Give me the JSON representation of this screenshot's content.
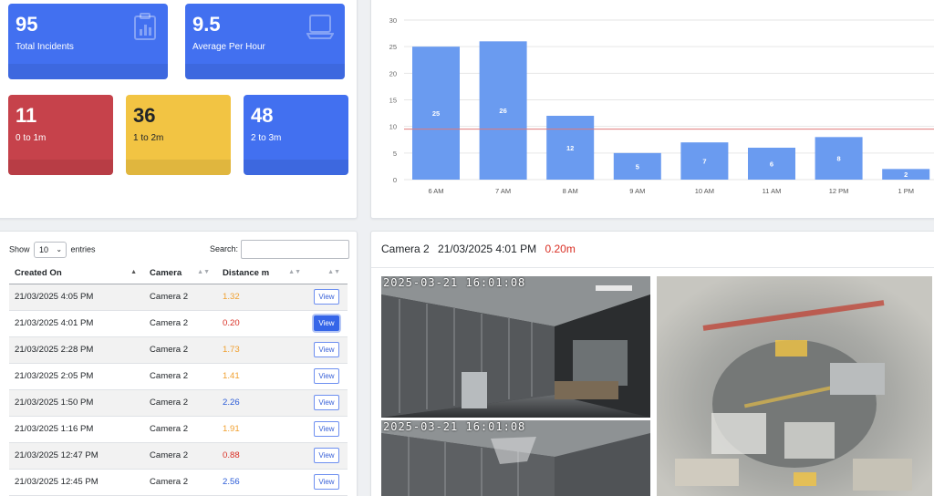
{
  "stats": {
    "total": {
      "value": "95",
      "label": "Total Incidents",
      "icon": "clipboard-chart-icon"
    },
    "average": {
      "value": "9.5",
      "label": "Average Per Hour",
      "icon": "laptop-icon"
    },
    "range1": {
      "value": "11",
      "label": "0 to 1m"
    },
    "range2": {
      "value": "36",
      "label": "1 to 2m"
    },
    "range3": {
      "value": "48",
      "label": "2 to 3m"
    },
    "colors": {
      "blue": "#4270f0",
      "red": "#c6424b",
      "yellow": "#f2c443"
    }
  },
  "chart_data": {
    "type": "bar",
    "categories": [
      "6 AM",
      "7 AM",
      "8 AM",
      "9 AM",
      "10 AM",
      "11 AM",
      "12 PM",
      "1 PM"
    ],
    "values": [
      25,
      26,
      12,
      5,
      7,
      6,
      8,
      2
    ],
    "ylim": [
      0,
      30
    ],
    "yticks": [
      0,
      5,
      10,
      15,
      20,
      25,
      30
    ],
    "average_line": 9.5,
    "grid": true,
    "bar_color": "#6a9bf0",
    "line_color": "#e07a7a"
  },
  "table": {
    "show_label": "Show",
    "entries_value": "10",
    "entries_label": "entries",
    "search_label": "Search:",
    "headers": [
      "Created On",
      "Camera",
      "Distance m",
      ""
    ],
    "view_label": "View",
    "rows": [
      {
        "created": "21/03/2025 4:05 PM",
        "camera": "Camera 2",
        "distance": "1.32",
        "color": "#f0a030"
      },
      {
        "created": "21/03/2025 4:01 PM",
        "camera": "Camera 2",
        "distance": "0.20",
        "color": "#d93025"
      },
      {
        "created": "21/03/2025 2:28 PM",
        "camera": "Camera 2",
        "distance": "1.73",
        "color": "#f0a030"
      },
      {
        "created": "21/03/2025 2:05 PM",
        "camera": "Camera 2",
        "distance": "1.41",
        "color": "#f0a030"
      },
      {
        "created": "21/03/2025 1:50 PM",
        "camera": "Camera 2",
        "distance": "2.26",
        "color": "#2a5bd7"
      },
      {
        "created": "21/03/2025 1:16 PM",
        "camera": "Camera 2",
        "distance": "1.91",
        "color": "#f0a030"
      },
      {
        "created": "21/03/2025 12:47 PM",
        "camera": "Camera 2",
        "distance": "0.88",
        "color": "#d93025"
      },
      {
        "created": "21/03/2025 12:45 PM",
        "camera": "Camera 2",
        "distance": "2.56",
        "color": "#2a5bd7"
      }
    ],
    "active_row": 1
  },
  "camera": {
    "name": "Camera 2",
    "datetime": "21/03/2025 4:01 PM",
    "distance": "0.20m",
    "stamp_top": "2025-03-21 16:01:08",
    "stamp_bottom": "2025-03-21 16:01:08"
  }
}
